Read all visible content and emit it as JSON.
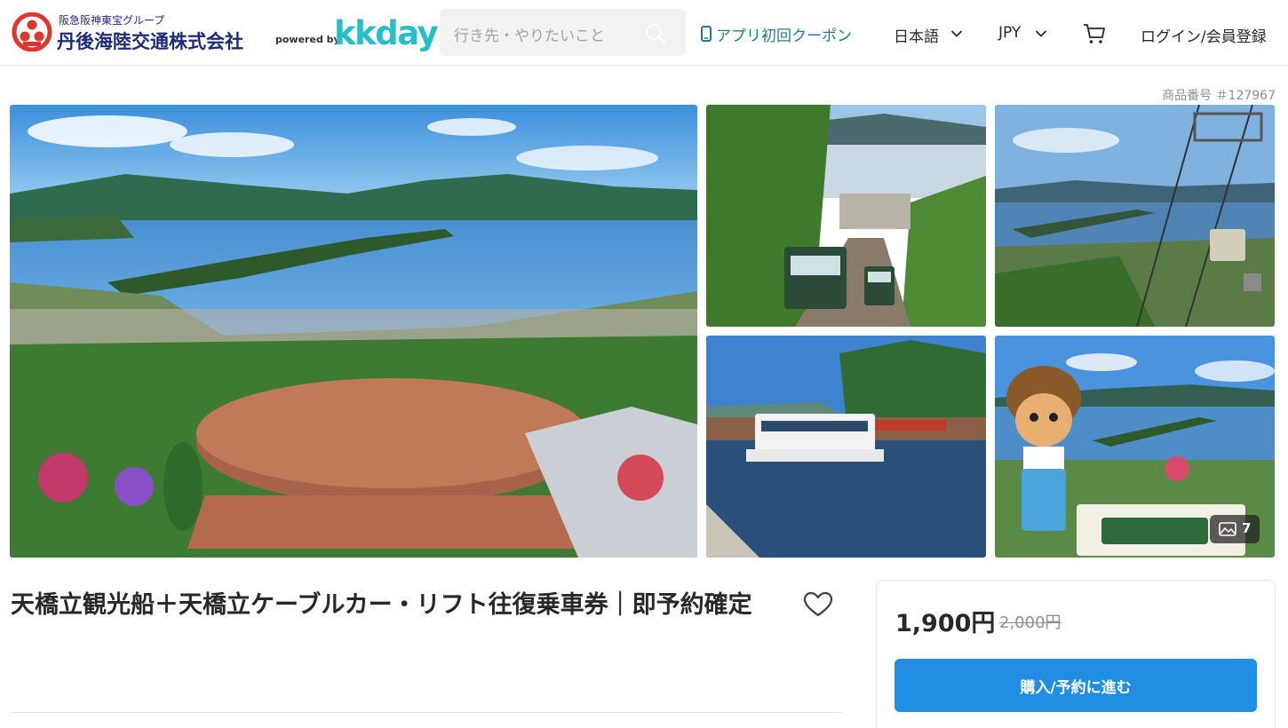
{
  "header": {
    "brand_sub": "阪急阪神東宝グループ",
    "brand_main": "丹後海陸交通株式会社",
    "powered_by": "powered by",
    "kkday_logo": "kkday",
    "search_placeholder": "行き先・やりたいこと",
    "coupon_label": "アプリ初回クーポン",
    "language_label": "日本語",
    "currency_label": "JPY",
    "login_label": "ログイン/会員登録",
    "icons": [
      "search-icon",
      "phone-icon",
      "chevron-down-icon",
      "cart-icon"
    ]
  },
  "product": {
    "product_number": "商品番号 ＃127967",
    "title": "天橋立観光船＋天橋立ケーブルカー・リフト往復乗車券｜即予約確定",
    "photo_count": "7",
    "price": "1,900円",
    "original_price": "2,000円",
    "book_button_label": "購入/予約に進む"
  },
  "gallery": {
    "images": [
      "main-viewpoint-photo",
      "cable-car-photo",
      "chairlift-photo",
      "sightseeing-boat-photo",
      "mascot-photo"
    ]
  },
  "colors": {
    "brand_navy": "#1e2a7a",
    "kkday_teal": "#26bec9",
    "coupon_teal": "#1a7f8e",
    "button_blue": "#1f8ee3",
    "logo_red": "#e2352b"
  }
}
